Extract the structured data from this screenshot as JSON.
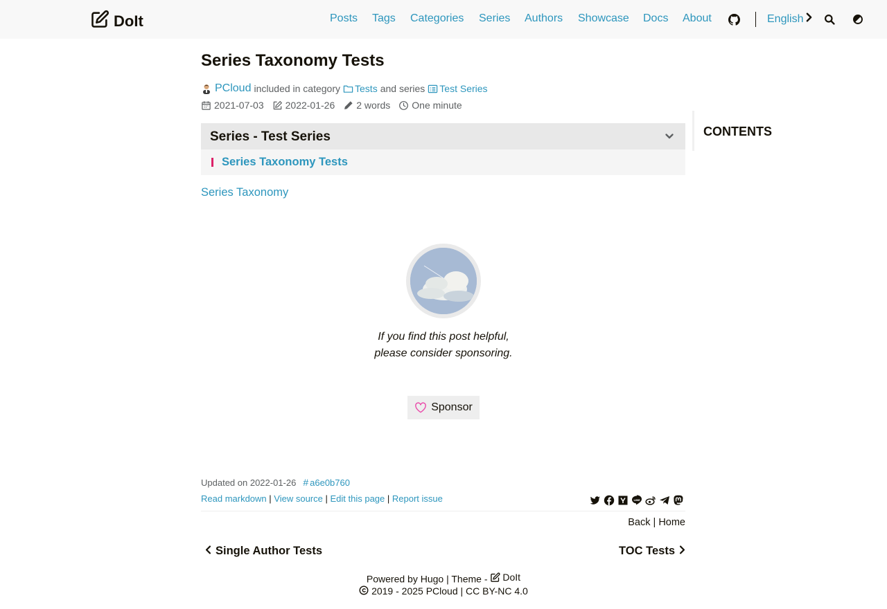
{
  "header": {
    "logo_text": "DoIt",
    "nav": [
      "Posts",
      "Tags",
      "Categories",
      "Series",
      "Authors",
      "Showcase",
      "Docs",
      "About"
    ],
    "language": "English"
  },
  "post": {
    "title": "Series Taxonomy Tests",
    "author": "PCloud",
    "included_in_category": "included in category",
    "category": "Tests",
    "and_series": "and series",
    "series": "Test Series",
    "published": "2021-07-03",
    "modified": "2022-01-26",
    "word_count": "2 words",
    "reading_time": "One minute"
  },
  "series_box": {
    "heading": "Series - Test Series",
    "items": [
      "Series Taxonomy Tests"
    ]
  },
  "body": {
    "link_text": "Series Taxonomy"
  },
  "sponsor": {
    "text": "If you find this post helpful, please consider sponsoring.",
    "button": "Sponsor"
  },
  "post_footer": {
    "updated": "Updated on 2022-01-26",
    "commit": "a6e0b760",
    "read_markdown": "Read markdown",
    "view_source": "View source",
    "edit_page": "Edit this page",
    "report_issue": "Report issue",
    "back": "Back",
    "home": "Home"
  },
  "pagination": {
    "prev": "Single Author Tests",
    "next": "TOC Tests"
  },
  "toc": {
    "title": "CONTENTS"
  },
  "footer": {
    "powered_by": "Powered by",
    "hugo": "Hugo",
    "theme": "Theme -",
    "theme_name": "DoIt",
    "copyright": "2019 - 2025",
    "owner": "PCloud",
    "license": "CC BY-NC 4.0"
  },
  "colors": {
    "accent": "#2d96bd",
    "series_bar": "#dc2268",
    "text": "#161209",
    "muted": "#5d6062",
    "heart": "#ea4aaa"
  },
  "icons": {
    "logo": "pen-to-square-icon",
    "github": "github-icon",
    "language_arrow": "chevron-right-icon",
    "search": "search-icon",
    "theme": "circle-half-icon",
    "share": [
      "twitter-icon",
      "facebook-icon",
      "hackernews-icon",
      "line-icon",
      "weibo-icon",
      "telegram-icon",
      "mastodon-icon"
    ]
  }
}
